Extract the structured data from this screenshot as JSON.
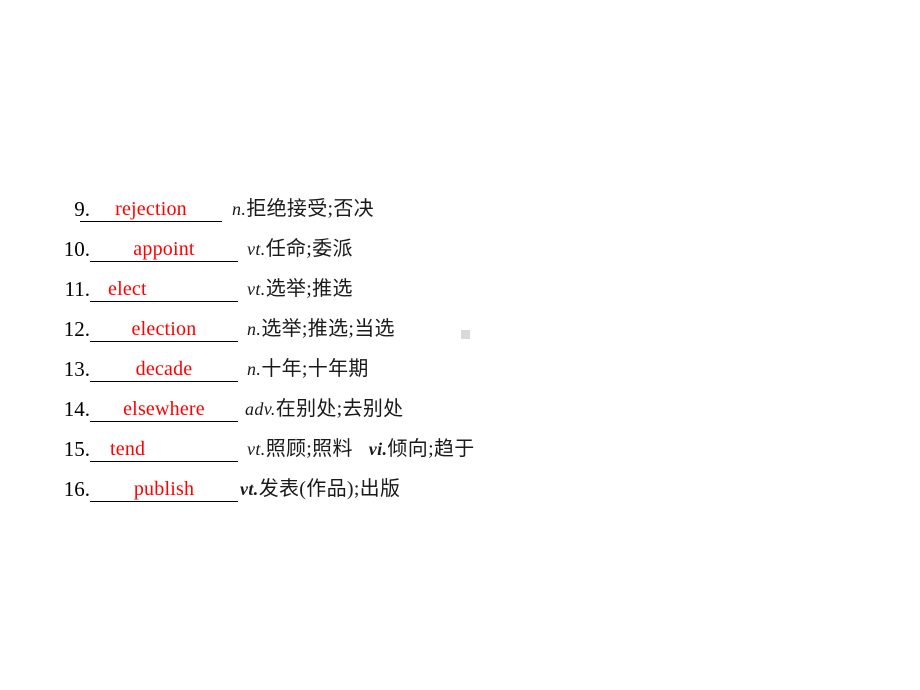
{
  "slide": {
    "background_color": "#ffffff",
    "answer_color": "#ff0000",
    "text_color": "#000000",
    "artifact_color": "#d9d9d9"
  },
  "vocab": {
    "items": [
      {
        "number": "9.",
        "answer": "rejection",
        "pos": "n.",
        "pos_bold": false,
        "gloss": "拒绝接受;否决",
        "pos2": "",
        "pos2_bold": false,
        "gloss2": ""
      },
      {
        "number": "10.",
        "answer": "appoint",
        "pos": "vt.",
        "pos_bold": false,
        "gloss": "任命;委派",
        "pos2": "",
        "pos2_bold": false,
        "gloss2": ""
      },
      {
        "number": "11.",
        "answer": "elect",
        "pos": "vt.",
        "pos_bold": false,
        "gloss": "选举;推选",
        "pos2": "",
        "pos2_bold": false,
        "gloss2": ""
      },
      {
        "number": "12.",
        "answer": "election",
        "pos": "n.",
        "pos_bold": false,
        "gloss": "选举;推选;当选",
        "pos2": "",
        "pos2_bold": false,
        "gloss2": ""
      },
      {
        "number": "13.",
        "answer": "decade",
        "pos": "n.",
        "pos_bold": false,
        "gloss": "十年;十年期",
        "pos2": "",
        "pos2_bold": false,
        "gloss2": ""
      },
      {
        "number": "14.",
        "answer": "elsewhere",
        "pos": "adv.",
        "pos_bold": false,
        "gloss": "在别处;去别处",
        "pos2": "",
        "pos2_bold": false,
        "gloss2": ""
      },
      {
        "number": "15.",
        "answer": "tend",
        "pos": "vt.",
        "pos_bold": false,
        "gloss": "照顾;照料",
        "pos2": "vi.",
        "pos2_bold": true,
        "gloss2": "倾向;趋于"
      },
      {
        "number": "16.",
        "answer": "publish",
        "pos": "vt.",
        "pos_bold": true,
        "gloss": "发表(作品);出版",
        "pos2": "",
        "pos2_bold": false,
        "gloss2": ""
      }
    ]
  }
}
